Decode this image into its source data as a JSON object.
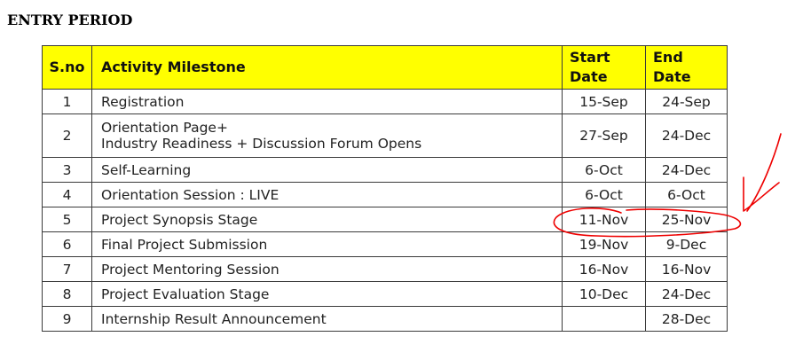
{
  "heading": "ENTRY PERIOD",
  "table": {
    "headers": {
      "sno": "S.no",
      "activity": "Activity Milestone",
      "start_line1": "Start",
      "start_line2": "Date",
      "end_line1": "End",
      "end_line2": "Date"
    },
    "rows": [
      {
        "sno": "1",
        "activity": "Registration",
        "activity_line2": "",
        "start": "15-Sep",
        "end": "24-Sep"
      },
      {
        "sno": "2",
        "activity": "Orientation Page+",
        "activity_line2": "Industry Readiness + Discussion Forum Opens",
        "start": "27-Sep",
        "end": "24-Dec"
      },
      {
        "sno": "3",
        "activity": "Self-Learning",
        "activity_line2": "",
        "start": "6-Oct",
        "end": "24-Dec"
      },
      {
        "sno": "4",
        "activity": "Orientation Session : LIVE",
        "activity_line2": "",
        "start": "6-Oct",
        "end": "6-Oct"
      },
      {
        "sno": "5",
        "activity": "Project Synopsis Stage",
        "activity_line2": "",
        "start": "11-Nov",
        "end": "25-Nov"
      },
      {
        "sno": "6",
        "activity": "Final Project Submission",
        "activity_line2": "",
        "start": "19-Nov",
        "end": "9-Dec"
      },
      {
        "sno": "7",
        "activity": "Project Mentoring Session",
        "activity_line2": "",
        "start": "16-Nov",
        "end": "16-Nov"
      },
      {
        "sno": "8",
        "activity": "Project Evaluation Stage",
        "activity_line2": "",
        "start": "10-Dec",
        "end": "24-Dec"
      },
      {
        "sno": "9",
        "activity": "Internship Result Announcement",
        "activity_line2": "",
        "start": "",
        "end": "28-Dec"
      }
    ]
  },
  "colors": {
    "header_background": "#ffff00",
    "annotation": "#ee0000"
  }
}
